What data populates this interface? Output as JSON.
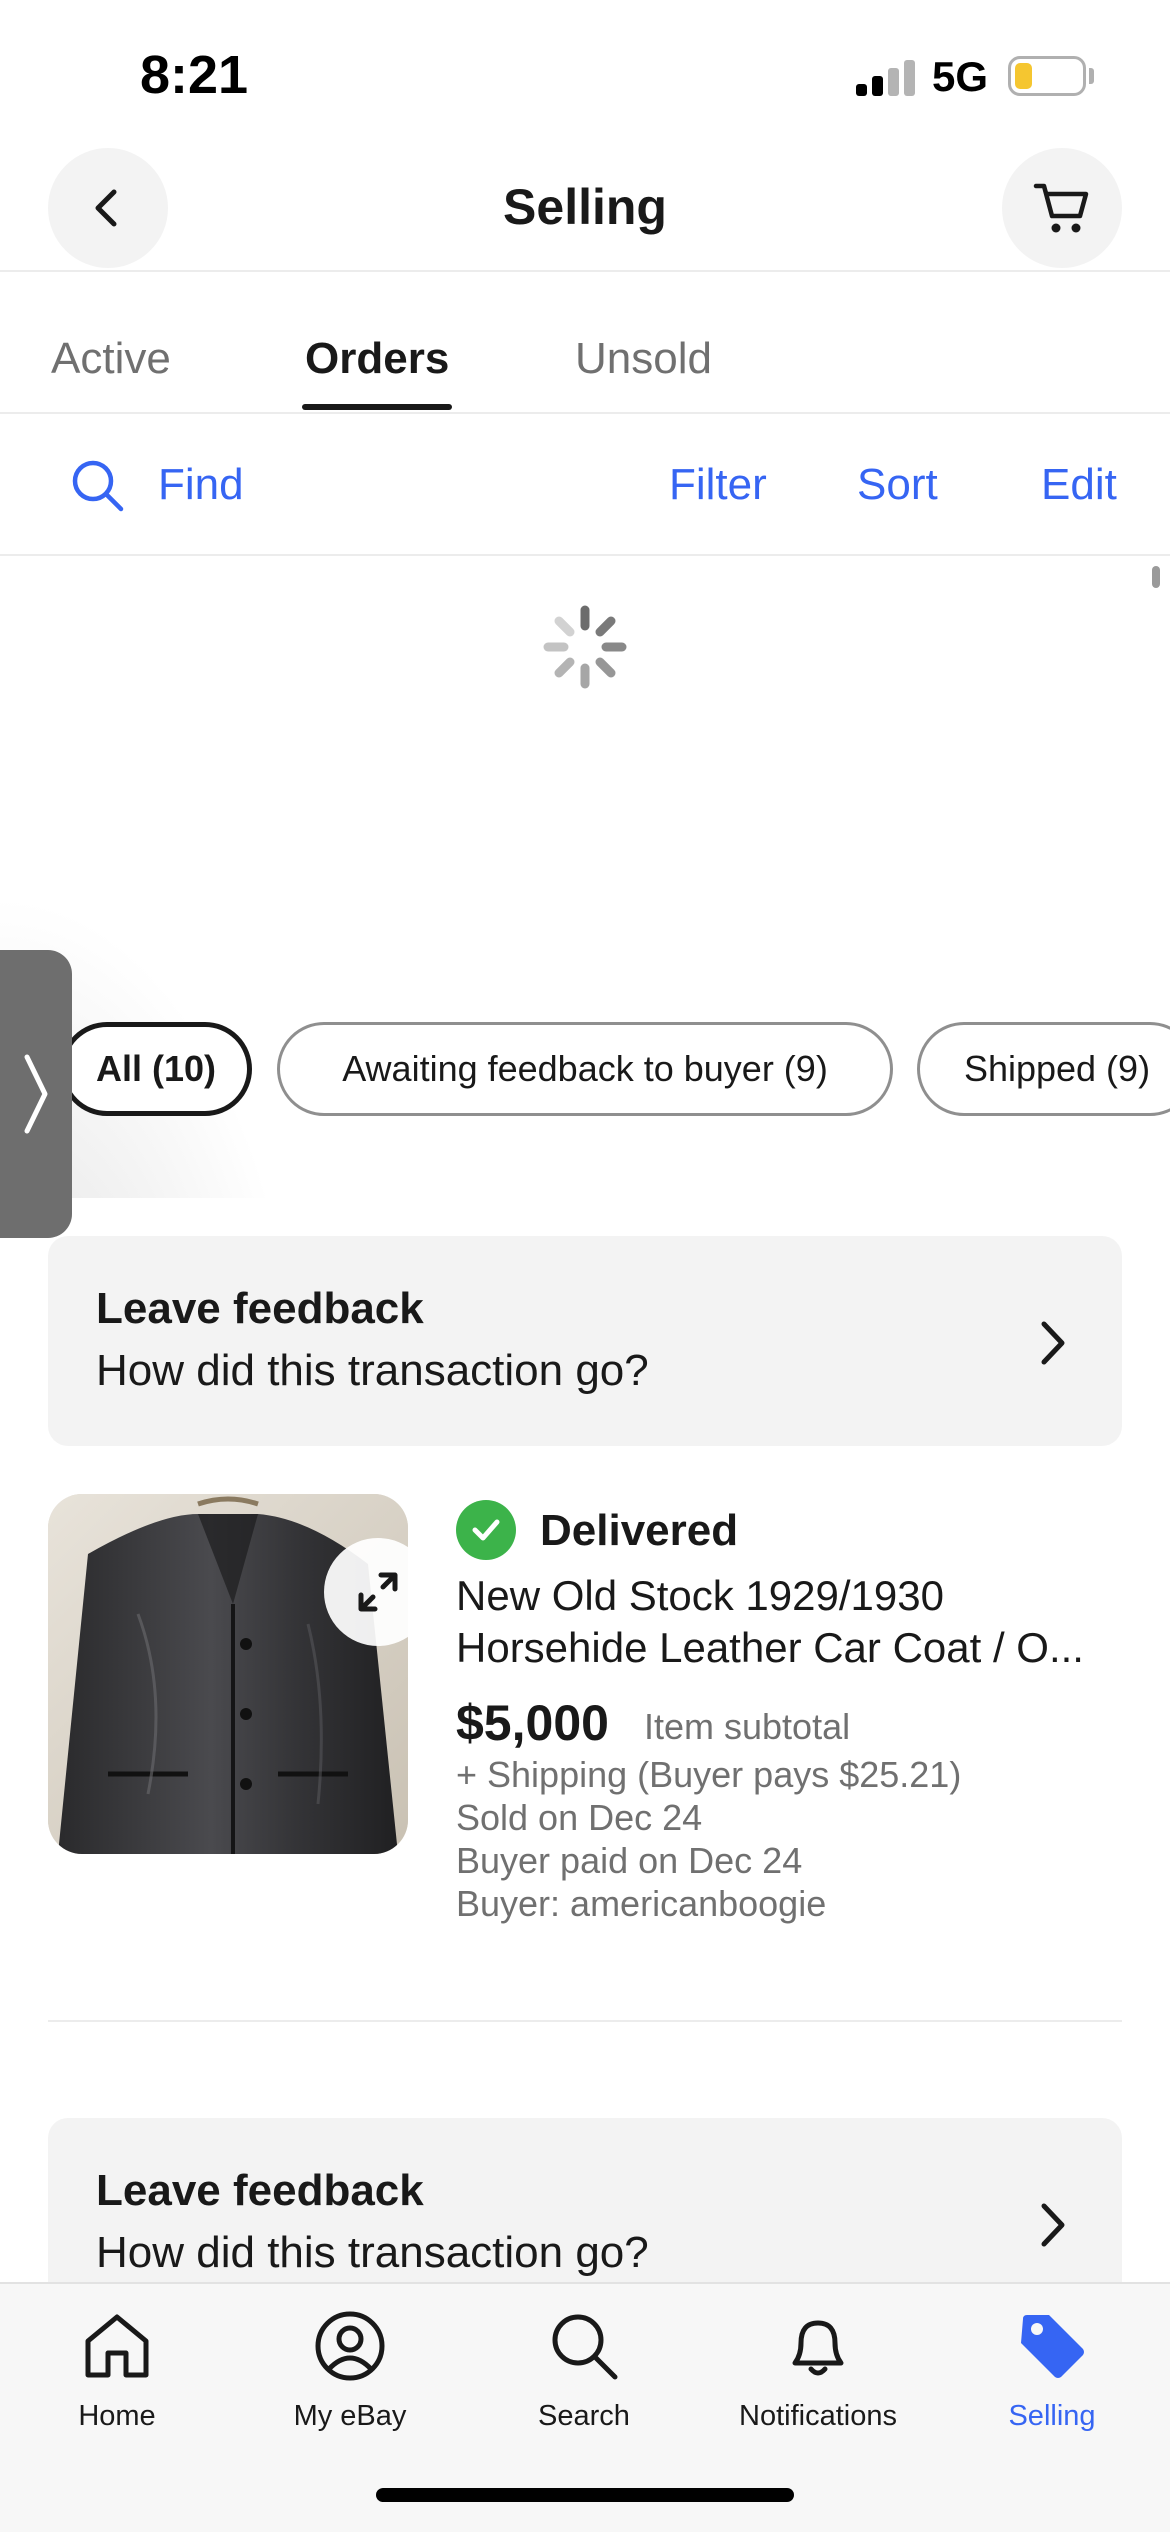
{
  "status_bar": {
    "time": "8:21",
    "network": "5G",
    "battery_level": 0.25,
    "battery_color": "#f5c630"
  },
  "header": {
    "title": "Selling",
    "back_icon": "chevron-left-icon",
    "cart_icon": "cart-icon"
  },
  "tabs": [
    {
      "label": "Active",
      "active": false
    },
    {
      "label": "Orders",
      "active": true
    },
    {
      "label": "Unsold",
      "active": false
    }
  ],
  "toolbar": {
    "find_label": "Find",
    "filter_label": "Filter",
    "sort_label": "Sort",
    "edit_label": "Edit"
  },
  "chips": [
    {
      "label": "All (10)",
      "selected": true
    },
    {
      "label": "Awaiting feedback to buyer (9)",
      "selected": false
    },
    {
      "label": "Shipped (9)",
      "selected": false
    }
  ],
  "feedback_prompts": [
    {
      "title": "Leave feedback",
      "subtitle": "How did this transaction go?"
    },
    {
      "title": "Leave feedback",
      "subtitle": "How did this transaction go?"
    }
  ],
  "order": {
    "status": "Delivered",
    "title_line1": "New Old Stock 1929/1930",
    "title_line2": "Horsehide Leather Car Coat / O...",
    "price": "$5,000",
    "price_note": "Item subtotal",
    "shipping": "+ Shipping (Buyer pays $25.21)",
    "sold_on": "Sold on Dec 24",
    "paid_on": "Buyer paid on Dec 24",
    "buyer": "Buyer: americanboogie"
  },
  "bottom_nav": [
    {
      "label": "Home",
      "icon": "home-icon",
      "active": false
    },
    {
      "label": "My eBay",
      "icon": "user-icon",
      "active": false
    },
    {
      "label": "Search",
      "icon": "search-icon",
      "active": false
    },
    {
      "label": "Notifications",
      "icon": "bell-icon",
      "active": false
    },
    {
      "label": "Selling",
      "icon": "tag-icon",
      "active": true
    }
  ],
  "colors": {
    "accent": "#3665f3",
    "success": "#3cb34a",
    "text_primary": "#191919",
    "text_secondary": "#707070"
  }
}
